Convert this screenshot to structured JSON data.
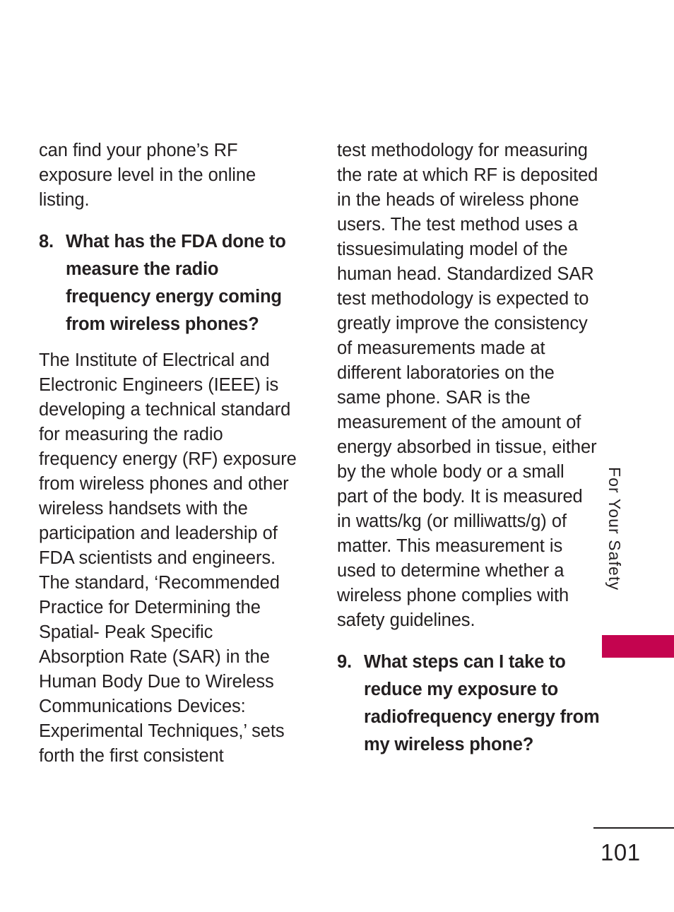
{
  "page": {
    "number": "101",
    "side_tab_label": "For Your Safety",
    "marker_color": "#c4044f",
    "text_color": "#231f20",
    "background_color": "#ffffff"
  },
  "columns": {
    "left": {
      "blocks": [
        {
          "type": "paragraph",
          "text": "can find your phone’s RF exposure level in the online listing."
        },
        {
          "type": "question",
          "number": "8.",
          "text": "What has the FDA done to measure the radio frequency energy coming from wireless phones?"
        },
        {
          "type": "paragraph",
          "text": "The Institute of Electrical and Electronic Engineers (IEEE) is developing a technical standard for measuring the radio frequency energy (RF) exposure from wireless phones and other wireless handsets with the participation and leadership of FDA scientists and engineers. The standard, ‘Recommended Practice for Determining the Spatial- Peak Specific Absorption Rate (SAR) in the Human Body Due to Wireless Communications Devices: Experimental Techniques,’ sets forth the first consistent"
        }
      ]
    },
    "right": {
      "blocks": [
        {
          "type": "paragraph",
          "text": "test methodology for measuring the rate at which RF is deposited in the heads of wireless phone users. The test method uses a tissuesimulating model of the human head. Standardized SAR test methodology is expected to greatly improve the consistency of measurements made at different laboratories on the same phone. SAR is the measurement of the amount of energy absorbed in tissue, either by the whole body or a small part of the body. It is measured in watts/kg (or milliwatts/g) of matter. This measurement is used to determine whether a wireless phone complies with safety guidelines."
        },
        {
          "type": "question",
          "number": "9.",
          "text": "What steps can I take to reduce my exposure to radiofrequency energy from my wireless phone?"
        }
      ]
    }
  }
}
